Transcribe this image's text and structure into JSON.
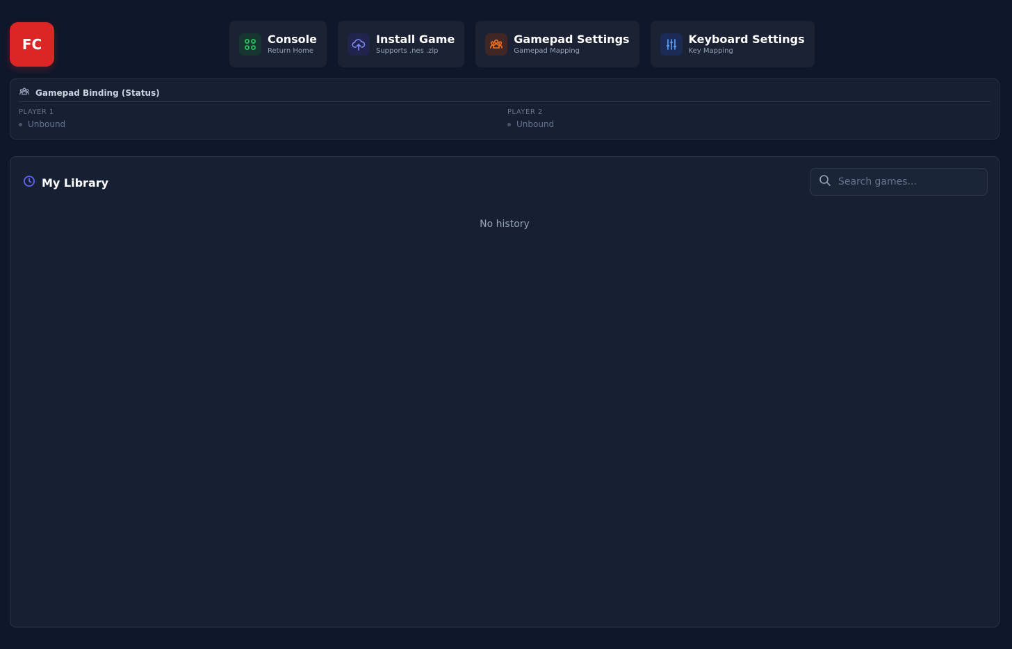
{
  "logo": {
    "text": "FC"
  },
  "nav": [
    {
      "title": "Console",
      "subtitle": "Return Home",
      "icon": "grid-icon",
      "color": "#22c55e"
    },
    {
      "title": "Install Game",
      "subtitle": "Supports .nes .zip",
      "icon": "upload-cloud-icon",
      "color": "#818cf8"
    },
    {
      "title": "Gamepad Settings",
      "subtitle": "Gamepad Mapping",
      "icon": "users-icon",
      "color": "#f97316"
    },
    {
      "title": "Keyboard Settings",
      "subtitle": "Key Mapping",
      "icon": "sliders-icon",
      "color": "#60a5fa"
    }
  ],
  "status": {
    "title": "Gamepad Binding (Status)",
    "players": [
      {
        "label": "PLAYER 1",
        "state": "Unbound"
      },
      {
        "label": "PLAYER 2",
        "state": "Unbound"
      }
    ]
  },
  "library": {
    "title": "My Library",
    "search_placeholder": "Search games...",
    "empty_text": "No history"
  },
  "colors": {
    "background": "#0f172a",
    "panel": "#172033",
    "logo": "#dc2626"
  }
}
